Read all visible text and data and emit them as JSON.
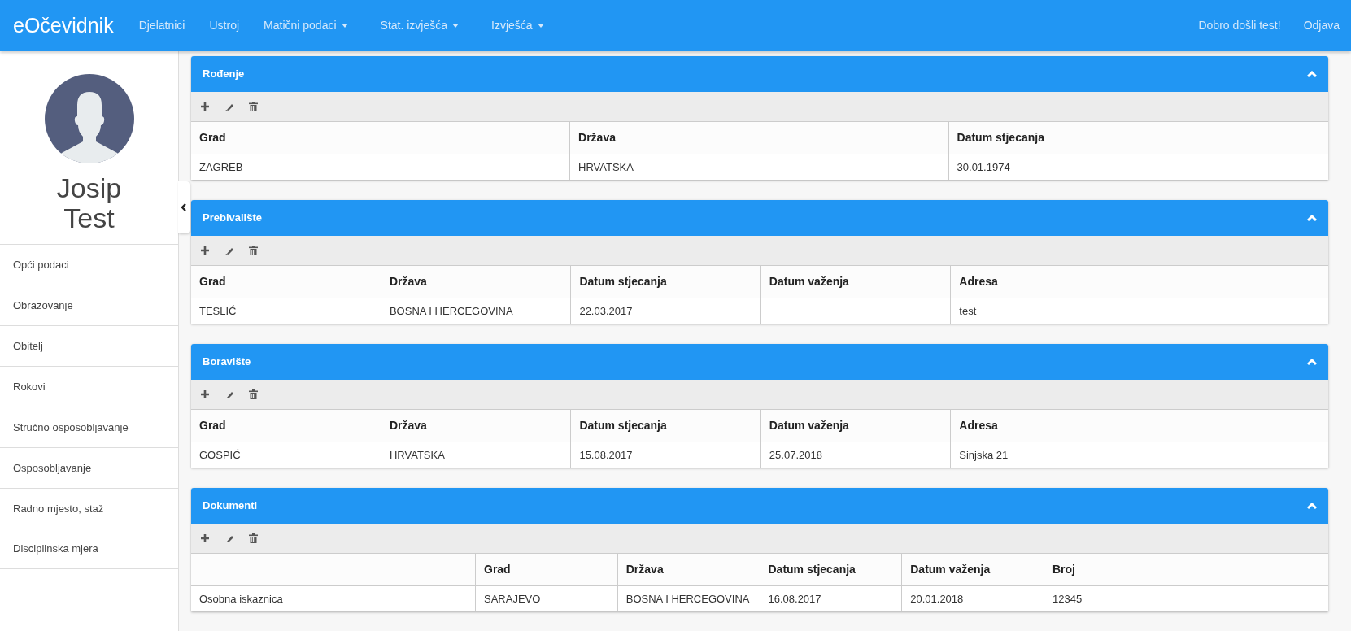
{
  "navbar": {
    "brand": "eOčevidnik",
    "items": [
      {
        "label": "Djelatnici",
        "dropdown": false
      },
      {
        "label": "Ustroj",
        "dropdown": false
      },
      {
        "label": "Matični podaci",
        "dropdown": true
      },
      {
        "label": "Stat. izvješća",
        "dropdown": true
      },
      {
        "label": "Izvješća",
        "dropdown": true
      }
    ],
    "right": [
      "Dobro došli test!",
      "Odjava"
    ]
  },
  "sidebar": {
    "first_name": "Josip",
    "last_name": "Test",
    "items": [
      "Opći podaci",
      "Obrazovanje",
      "Obitelj",
      "Rokovi",
      "Stručno osposobljavanje",
      "Osposobljavanje",
      "Radno mjesto, staž",
      "Disciplinska mjera"
    ]
  },
  "panels": [
    {
      "title": "Rođenje",
      "expanded": true,
      "columns": [
        {
          "label": "Grad"
        },
        {
          "label": "Država"
        },
        {
          "label": "Datum stjecanja"
        }
      ],
      "rows": [
        [
          "ZAGREB",
          "HRVATSKA",
          "30.01.1974"
        ]
      ]
    },
    {
      "title": "Prebivalište",
      "expanded": true,
      "columns": [
        {
          "label": "Grad"
        },
        {
          "label": "Država"
        },
        {
          "label": "Datum stjecanja"
        },
        {
          "label": "Datum važenja"
        },
        {
          "label": "Adresa"
        }
      ],
      "rows": [
        [
          "TESLIĆ",
          "BOSNA I HERCEGOVINA",
          "22.03.2017",
          null,
          "test"
        ]
      ]
    },
    {
      "title": "Boravište",
      "expanded": true,
      "columns": [
        {
          "label": "Grad"
        },
        {
          "label": "Država"
        },
        {
          "label": "Datum stjecanja"
        },
        {
          "label": "Datum važenja"
        },
        {
          "label": "Adresa"
        }
      ],
      "rows": [
        [
          "GOSPIĆ",
          "HRVATSKA",
          "15.08.2017",
          "25.07.2018",
          "Sinjska 21"
        ]
      ]
    },
    {
      "title": "Dokumenti",
      "expanded": true,
      "columns": [
        {},
        {
          "label": "Grad"
        },
        {
          "label": "Država"
        },
        {
          "label": "Datum stjecanja"
        },
        {
          "label": "Datum važenja"
        },
        {
          "label": "Broj"
        }
      ],
      "rows": [
        [
          "Osobna iskaznica",
          "SARAJEVO",
          "BOSNA I HERCEGOVINA",
          "16.08.2017",
          "20.01.2018",
          "12345"
        ]
      ]
    }
  ]
}
